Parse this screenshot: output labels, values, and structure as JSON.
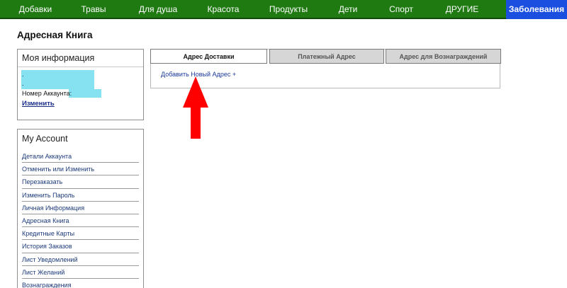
{
  "nav": {
    "items": [
      "Добавки",
      "Травы",
      "Для душа",
      "Красота",
      "Продукты",
      "Дети",
      "Спорт",
      "ДРУГИЕ",
      "Заболевания"
    ],
    "active_index": 8,
    "bg_color": "#1f7a12",
    "active_color": "#1a4fe0"
  },
  "page": {
    "title": "Адресная Книга"
  },
  "info": {
    "title": "Моя информация",
    "line1": ".",
    "line2": ".",
    "account_label": "Номер Аккаунта: ",
    "edit": "Изменить"
  },
  "account": {
    "title": "My Account",
    "items": [
      "Детали Аккаунта",
      "Отменить или Изменить",
      "Перезаказать",
      "Изменить Пароль",
      "Личная Информация",
      "Адресная Книга",
      "Кредитные Карты",
      "История Заказов",
      "Лист Уведомлений",
      "Лист Желаний",
      "Вознаграждения"
    ]
  },
  "tabs": {
    "items": [
      "Адрес Доставки",
      "Платежный Адрес",
      "Адрес для Вознаграждений"
    ],
    "active_index": 0,
    "add_address": "Добавить Новый Адрес +"
  },
  "annotation": {
    "arrow_color": "#ff0000",
    "arrow_icon": "up-arrow-icon"
  }
}
